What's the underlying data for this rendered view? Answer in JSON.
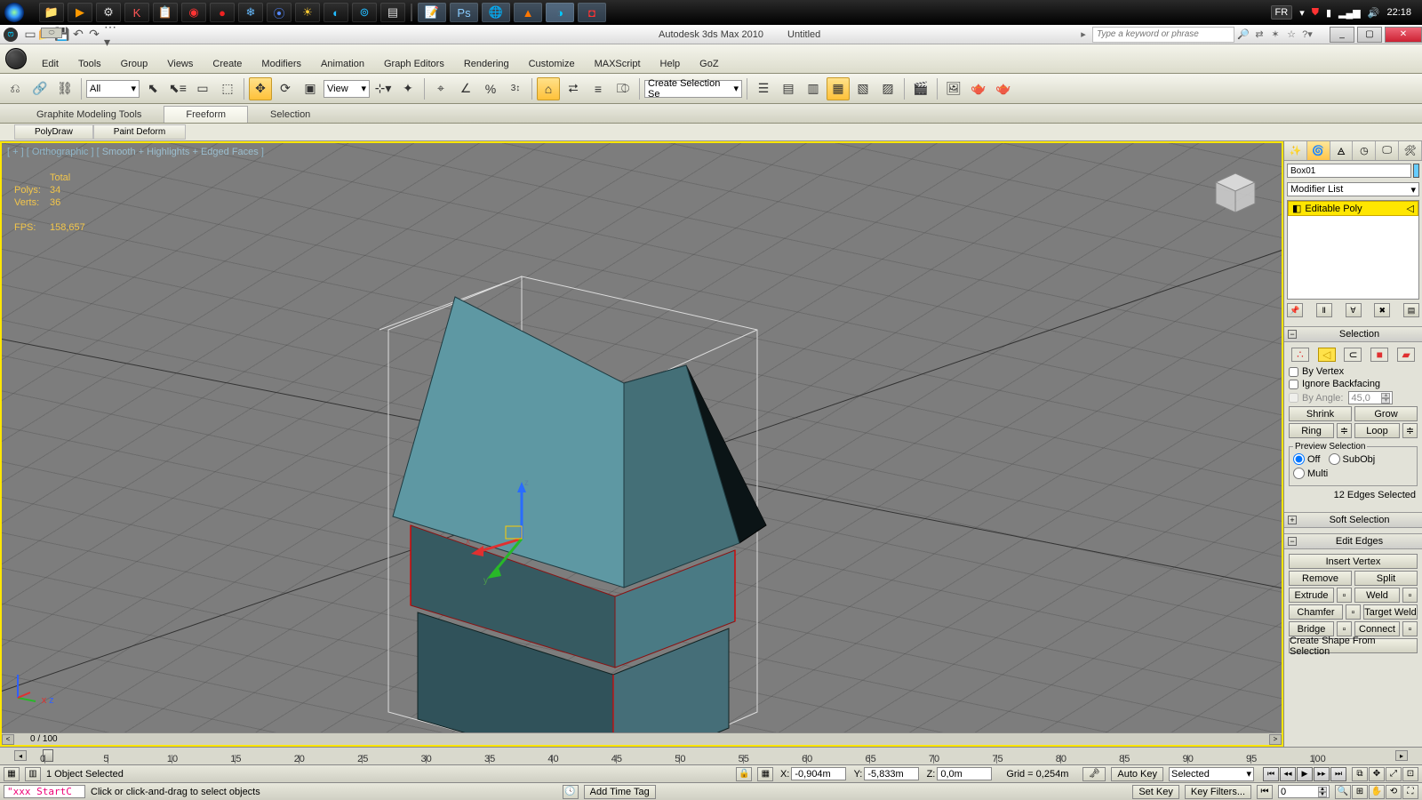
{
  "taskbar": {
    "lang": "FR",
    "clock": "22:18"
  },
  "titlebar": {
    "app": "Autodesk 3ds Max 2010",
    "doc": "Untitled",
    "search_placeholder": "Type a keyword or phrase",
    "min": "_",
    "max": "▢",
    "close": "✕"
  },
  "menu": [
    "Edit",
    "Tools",
    "Group",
    "Views",
    "Create",
    "Modifiers",
    "Animation",
    "Graph Editors",
    "Rendering",
    "Customize",
    "MAXScript",
    "Help",
    "GoZ"
  ],
  "toolbar": {
    "selset_placeholder": "Create Selection Se",
    "layer_filter": "All",
    "view_label": "View"
  },
  "ribbon": {
    "tabs": [
      "Graphite Modeling Tools",
      "Freeform",
      "Selection"
    ],
    "active": 1,
    "sub": [
      "PolyDraw",
      "Paint Deform"
    ]
  },
  "viewport": {
    "label_prefix": "[ + ] [ Orthographic ] [ ",
    "label_mode": "Smooth + Highlights + Edged Faces",
    "label_suffix": " ]",
    "stats": {
      "total": "Total",
      "polys_k": "Polys:",
      "polys_v": "34",
      "verts_k": "Verts:",
      "verts_v": "36",
      "fps_k": "FPS:",
      "fps_v": "158,657"
    },
    "frame": "0 / 100",
    "scroll_left": "<",
    "scroll_right": ">"
  },
  "gizmo": {
    "x": "x",
    "y": "y",
    "z": "z"
  },
  "cmd": {
    "objname": "Box01",
    "modlist": "Modifier List",
    "stack_item": "Editable Poly",
    "dd": "▾",
    "rollouts": {
      "selection": "Selection",
      "soft": "Soft Selection",
      "editedges": "Edit Edges"
    },
    "selection_panel": {
      "by_vertex": "By Vertex",
      "ignore_bf": "Ignore Backfacing",
      "by_angle": "By Angle:",
      "angle_val": "45,0",
      "shrink": "Shrink",
      "grow": "Grow",
      "ring": "Ring",
      "loop": "Loop",
      "preview": "Preview Selection",
      "off": "Off",
      "subobj": "SubObj",
      "multi": "Multi",
      "edges_selected": "12 Edges Selected"
    },
    "editedges_panel": {
      "insert_vertex": "Insert Vertex",
      "remove": "Remove",
      "split": "Split",
      "extrude": "Extrude",
      "weld": "Weld",
      "chamfer": "Chamfer",
      "target_weld": "Target Weld",
      "bridge": "Bridge",
      "connect": "Connect",
      "create_shape": "Create Shape From Selection"
    },
    "plus": "+",
    "minus": "−"
  },
  "timeline": {
    "ticks": [
      "0",
      "5",
      "10",
      "15",
      "20",
      "25",
      "30",
      "35",
      "40",
      "45",
      "50",
      "55",
      "60",
      "65",
      "70",
      "75",
      "80",
      "85",
      "90",
      "95",
      "100"
    ]
  },
  "status1": {
    "sel": "1 Object Selected",
    "x_l": "X:",
    "x_v": "-0,904m",
    "y_l": "Y:",
    "y_v": "-5,833m",
    "z_l": "Z:",
    "z_v": "0,0m",
    "grid": "Grid = 0,254m",
    "autokey": "Auto Key",
    "selected": "Selected"
  },
  "status2": {
    "mx": "\"xxx StartC",
    "prompt": "Click or click-and-drag to select objects",
    "lock": "🔒",
    "addtag": "Add Time Tag",
    "setkey": "Set Key",
    "keyfilters": "Key Filters...",
    "framebox": "0"
  }
}
